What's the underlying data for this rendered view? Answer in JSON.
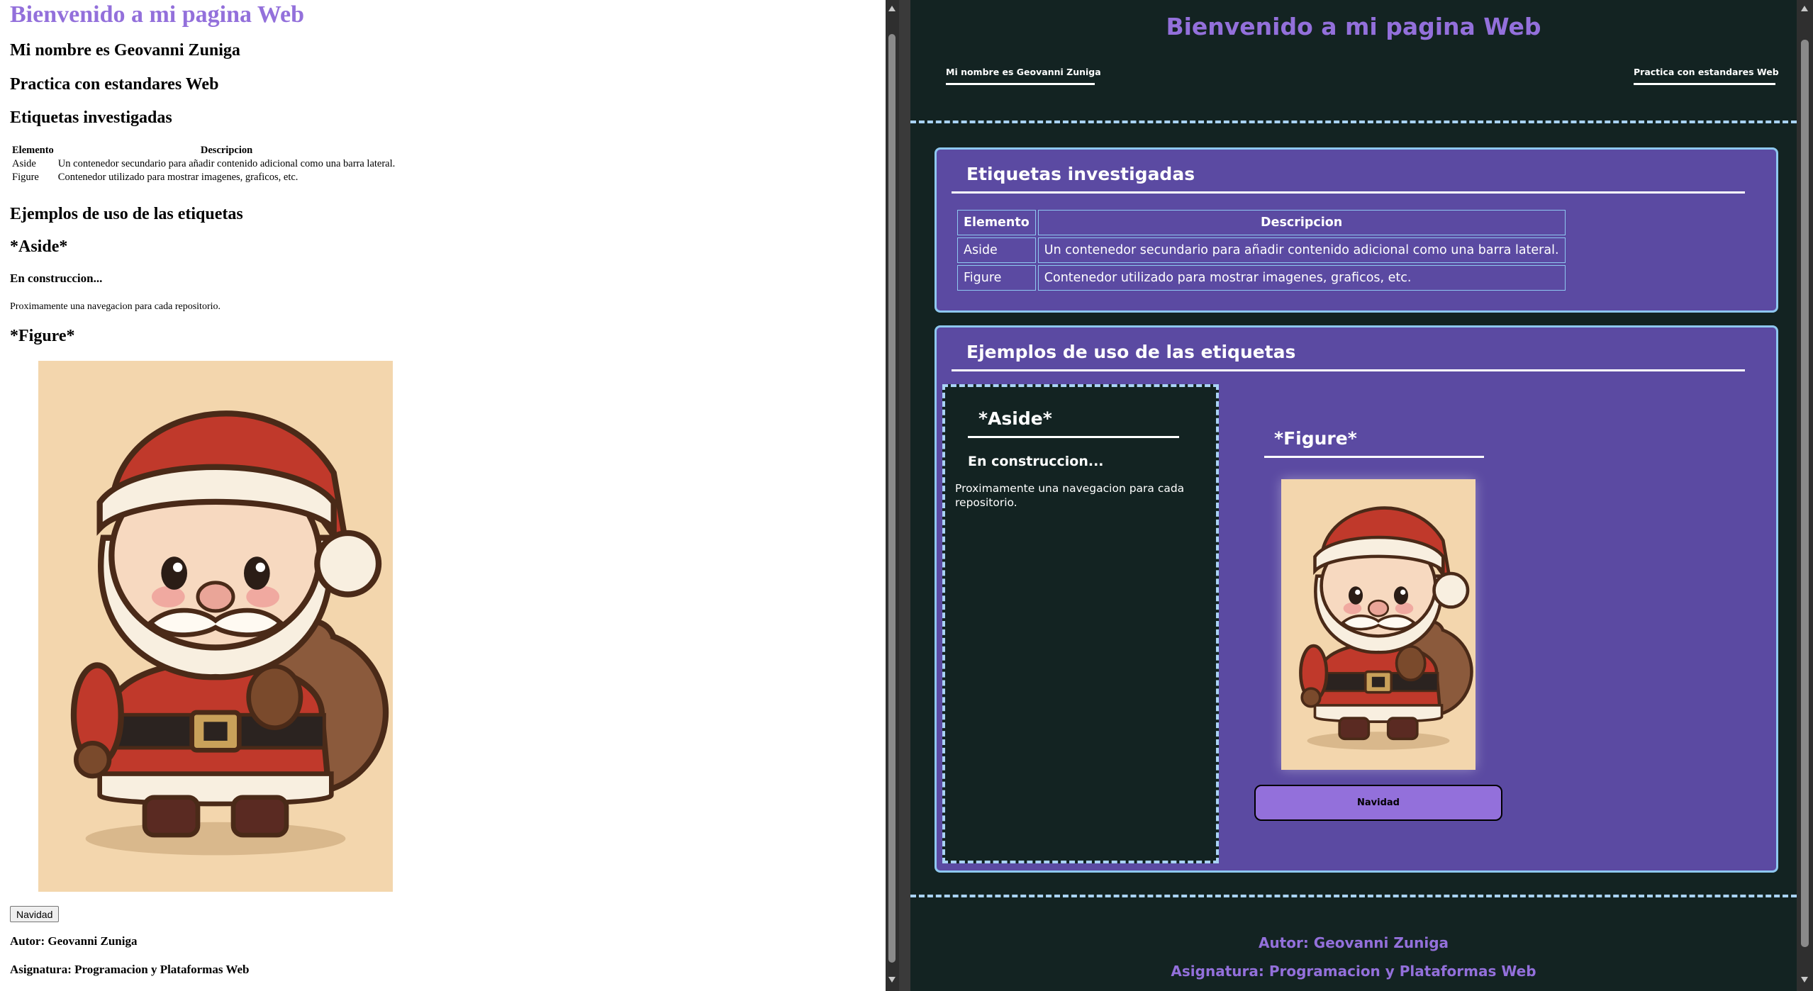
{
  "page": {
    "title": "Bienvenido a mi pagina Web",
    "name_heading": "Mi nombre es Geovanni Zuniga",
    "practice_heading": "Practica con estandares Web",
    "tags_heading": "Etiquetas investigadas",
    "table": {
      "headers": [
        "Elemento",
        "Descripcion"
      ],
      "rows": [
        [
          "Aside",
          "Un contenedor secundario para añadir contenido adicional como una barra lateral."
        ],
        [
          "Figure",
          "Contenedor utilizado para mostrar imagenes, graficos, etc."
        ]
      ]
    },
    "examples_heading": "Ejemplos de uso de las etiquetas",
    "aside": {
      "heading": "*Aside*",
      "subheading": "En construccion...",
      "text": "Proximamente una navegacion para cada repositorio."
    },
    "figure": {
      "heading": "*Figure*",
      "button_label": "Navidad"
    },
    "footer": {
      "author": "Autor: Geovanni Zuniga",
      "subject": "Asignatura: Programacion y Plataformas Web"
    }
  },
  "icons": [
    "santa-claus-illustration",
    "scroll-up-arrow-icon",
    "scroll-down-arrow-icon"
  ],
  "colors": {
    "accent_purple": "#9370db",
    "panel_purple": "#5b4aa2",
    "dark_background": "#132322",
    "border_light_blue": "#8ec8f0",
    "dashed_line": "#a9d3f5"
  }
}
